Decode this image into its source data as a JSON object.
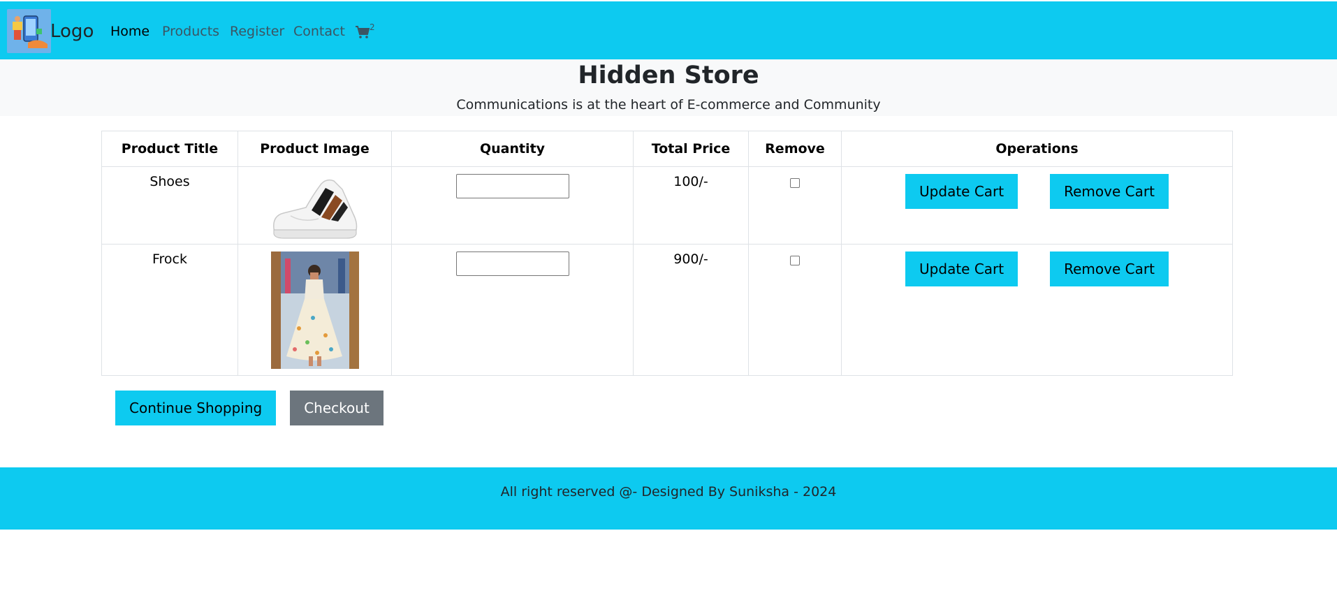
{
  "nav": {
    "logo_text": "Logo",
    "links": [
      "Home",
      "Products",
      "Register",
      "Contact"
    ],
    "cart_count": "2"
  },
  "hero": {
    "title": "Hidden Store",
    "subtitle": "Communications is at the heart of E-commerce and Community"
  },
  "table": {
    "headers": [
      "Product Title",
      "Product Image",
      "Quantity",
      "Total Price",
      "Remove",
      "Operations"
    ],
    "rows": [
      {
        "title": "Shoes",
        "price": "100/-",
        "qty_value": "",
        "update_label": "Update Cart",
        "remove_label": "Remove Cart"
      },
      {
        "title": "Frock",
        "price": "900/-",
        "qty_value": "",
        "update_label": "Update Cart",
        "remove_label": "Remove Cart"
      }
    ]
  },
  "actions": {
    "continue_label": "Continue Shopping",
    "checkout_label": "Checkout"
  },
  "footer": {
    "text": "All right reserved @- Designed By Suniksha - 2024"
  },
  "colors": {
    "accent": "#0dcaf0",
    "secondary": "#6c757d",
    "hero_bg": "#f8f9fa"
  }
}
